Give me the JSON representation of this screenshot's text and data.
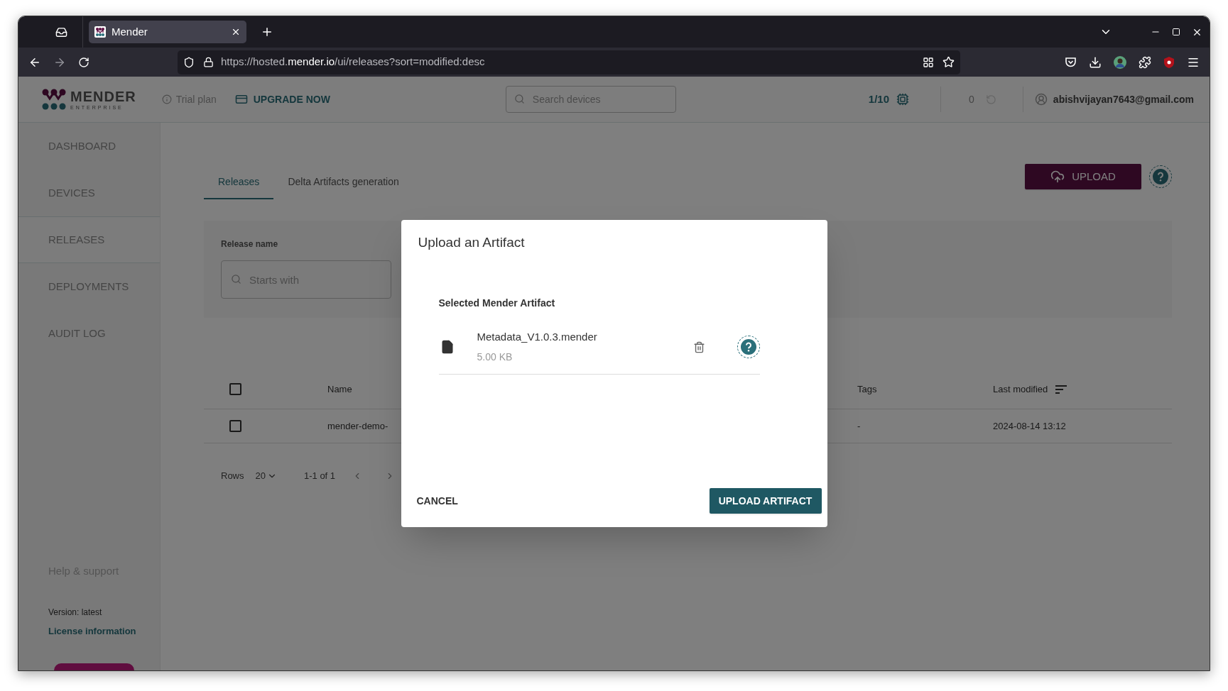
{
  "browser": {
    "tabs": [
      {
        "title": "Mender",
        "selected": true
      }
    ],
    "url": {
      "prefix": "https://hosted.",
      "domain": "mender.io",
      "path": "/ui/releases?sort=modified:desc"
    }
  },
  "header": {
    "logo": {
      "name": "MENDER",
      "sub": "ENTERPRISE"
    },
    "trial": "Trial plan",
    "upgrade": "UPGRADE NOW",
    "search": {
      "placeholder": "Search devices"
    },
    "device_count": "1/10",
    "pending": "0",
    "user": "abishvijayan7643@gmail.com"
  },
  "sidebar": {
    "items": [
      {
        "label": "DASHBOARD",
        "selected": false
      },
      {
        "label": "DEVICES",
        "selected": false
      },
      {
        "label": "RELEASES",
        "selected": true
      },
      {
        "label": "DEPLOYMENTS",
        "selected": false
      },
      {
        "label": "AUDIT LOG",
        "selected": false
      }
    ],
    "help": "Help & support",
    "version": "Version: latest",
    "license": "License information"
  },
  "main": {
    "tabs": [
      {
        "label": "Releases",
        "selected": true
      },
      {
        "label": "Delta Artifacts generation",
        "selected": false
      }
    ],
    "upload": "UPLOAD",
    "filter": {
      "label": "Release name",
      "placeholder": "Starts with"
    },
    "table": {
      "header_checked": false,
      "columns": [
        "Name",
        "Tags",
        "Last modified"
      ],
      "rows": [
        {
          "checked": false,
          "name": "mender-demo-",
          "tags": "-",
          "modified": "2024-08-14 13:12"
        }
      ]
    },
    "pagination": {
      "rows_label": "Rows",
      "rows_value": "20",
      "range": "1-1 of 1"
    }
  },
  "dialog": {
    "title": "Upload an Artifact",
    "section": "Selected Mender Artifact",
    "file": {
      "name": "Metadata_V1.0.3.mender",
      "size": "5.00 KB"
    },
    "cancel": "CANCEL",
    "confirm": "UPLOAD ARTIFACT"
  }
}
